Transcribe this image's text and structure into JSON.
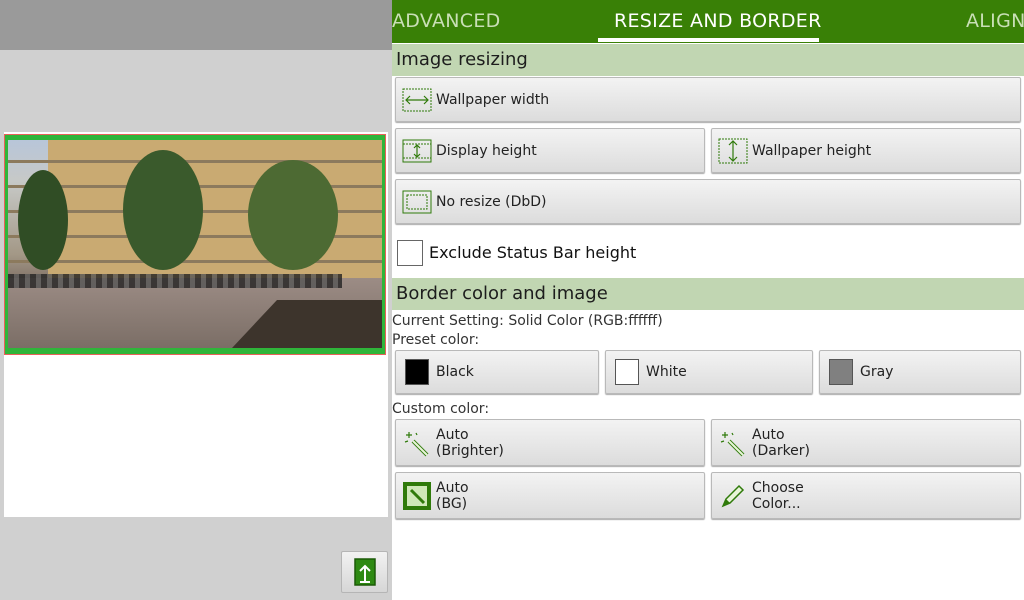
{
  "tabs": [
    {
      "label": "ADVANCED"
    },
    {
      "label": "RESIZE AND BORDER"
    },
    {
      "label": "ALIGN"
    }
  ],
  "active_tab": "RESIZE AND BORDER",
  "image_resizing": {
    "header": "Image resizing",
    "wallpaper_width": "Wallpaper width",
    "display_height": "Display height",
    "wallpaper_height": "Wallpaper height",
    "no_resize": "No resize (DbD)",
    "exclude_status_bar": "Exclude Status Bar height",
    "exclude_checked": false
  },
  "border": {
    "header": "Border color and image",
    "current_setting": "Current Setting: Solid Color (RGB:ffffff)",
    "preset_label": "Preset color:",
    "preset": [
      {
        "label": "Black",
        "color": "#000000"
      },
      {
        "label": "White",
        "color": "#ffffff"
      },
      {
        "label": "Gray",
        "color": "#808080"
      }
    ],
    "custom_label": "Custom color:",
    "auto_brighter": "Auto\n(Brighter)",
    "auto_darker": "Auto\n(Darker)",
    "auto_bg": "Auto\n(BG)",
    "choose_color": "Choose\nColor..."
  },
  "colors": {
    "accent": "#398006",
    "section_header": "#c1d6b2",
    "preview_border": "#2fb53a",
    "selection_outline": "#e8605a"
  }
}
